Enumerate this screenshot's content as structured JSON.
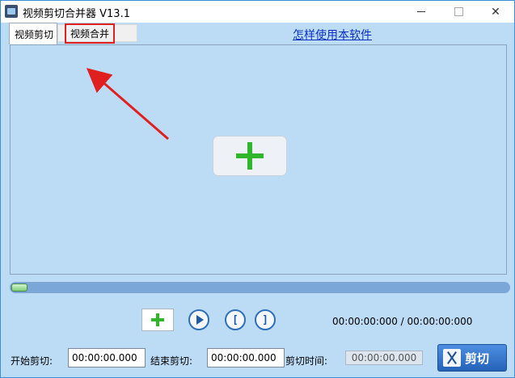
{
  "window": {
    "title": "视频剪切合并器 V13.1",
    "icons": {
      "app": "film-icon",
      "minimize": "minimize-icon",
      "maximize": "maximize-icon",
      "close": "close-icon"
    }
  },
  "tabs": [
    {
      "label": "视频剪切",
      "active": true
    },
    {
      "label": "视频合并",
      "active": false,
      "highlighted": true
    }
  ],
  "help_link": "怎样使用本软件",
  "preview": {
    "add_icon": "plus-icon"
  },
  "progress": {
    "value": 0
  },
  "controls": {
    "add_icon": "plus-icon",
    "play_icon": "play-icon",
    "mark_in_label": "[",
    "mark_out_label": "]",
    "time_display": "00:00:00:000 / 00:00:00:000"
  },
  "cut": {
    "start_label": "开始剪切:",
    "start_value": "00:00:00.000",
    "end_label": "结束剪切:",
    "end_value": "00:00:00.000",
    "duration_label": "剪切时间:",
    "duration_value": "00:00:00.000",
    "button_label": "剪切",
    "button_icon": "scissors-icon"
  },
  "colors": {
    "background": "#bcdcf6",
    "accent": "#2562b8",
    "highlight": "#e02020",
    "plus": "#2fb62b"
  }
}
